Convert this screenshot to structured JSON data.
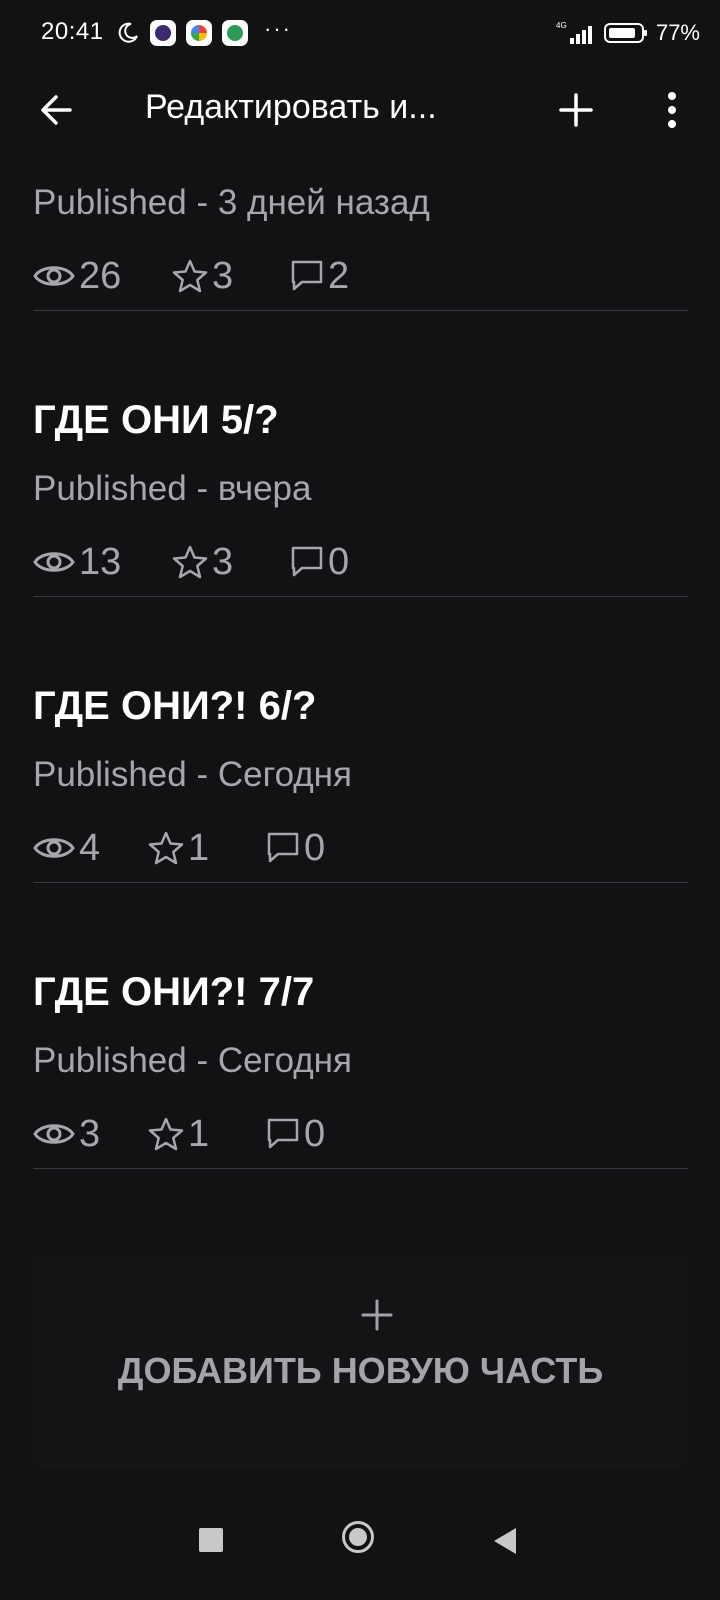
{
  "status_bar": {
    "time": "20:41",
    "more": "···",
    "network": "4G",
    "battery": "77%"
  },
  "app_bar": {
    "title": "Редактировать и...",
    "back_icon": "arrow-left-icon",
    "add_icon": "plus-icon",
    "menu_icon": "more-vertical-icon"
  },
  "parts": [
    {
      "title": "",
      "status": "Published - 3 дней назад",
      "views": "26",
      "stars": "3",
      "comments": "2"
    },
    {
      "title": "ГДЕ ОНИ 5/?",
      "status": "Published - вчера",
      "views": "13",
      "stars": "3",
      "comments": "0"
    },
    {
      "title": "ГДЕ ОНИ?! 6/?",
      "status": "Published - Сегодня",
      "views": "4",
      "stars": "1",
      "comments": "0"
    },
    {
      "title": "ГДЕ ОНИ?! 7/7",
      "status": "Published - Сегодня",
      "views": "3",
      "stars": "1",
      "comments": "0"
    }
  ],
  "add_part": {
    "icon": "plus-icon",
    "label": "ДОБАВИТЬ НОВУЮ ЧАСТЬ"
  },
  "colors": {
    "background": "#121114",
    "text_primary": "#ffffff",
    "text_secondary": "#a7a6ab",
    "divider": "#3a393d"
  }
}
